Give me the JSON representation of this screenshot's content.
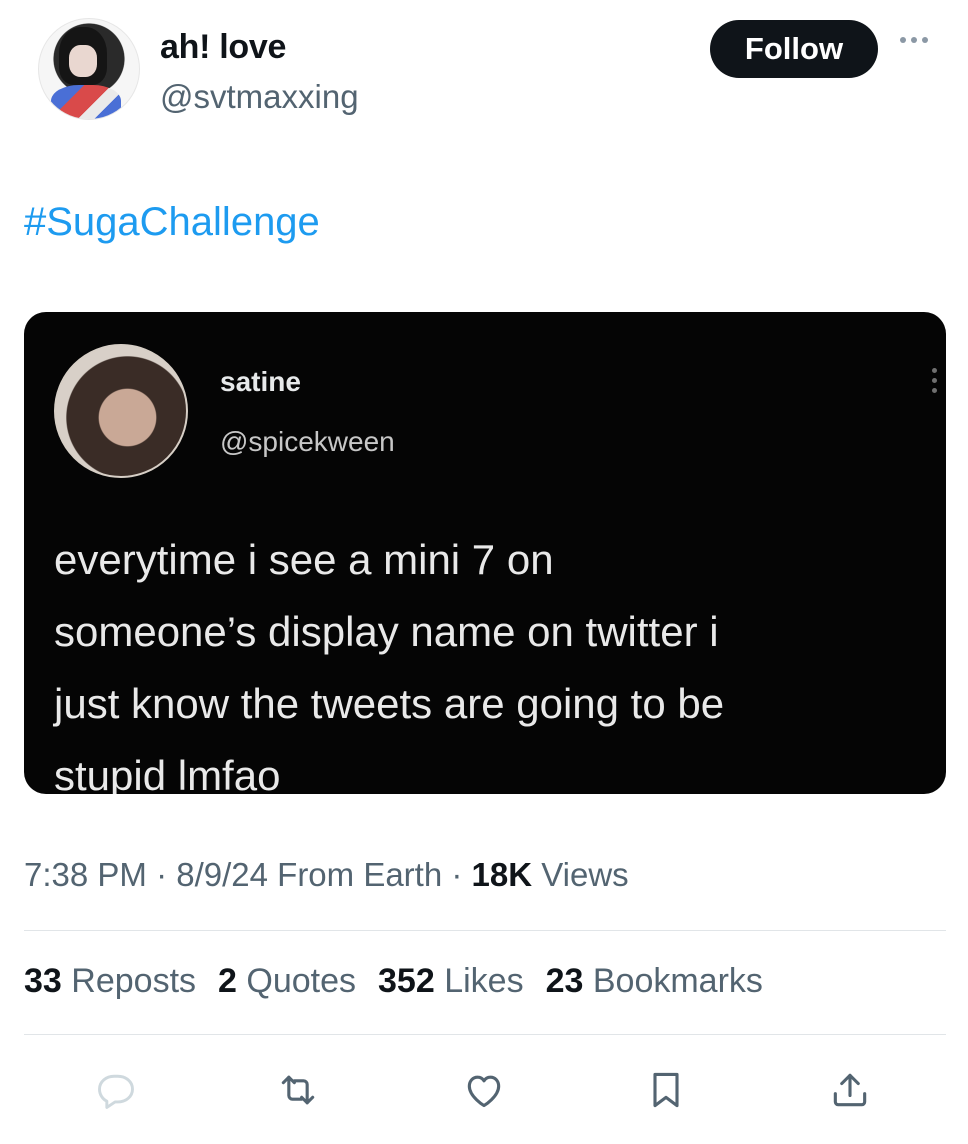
{
  "author": {
    "display_name": "ah! love",
    "handle": "@svtmaxxing",
    "follow_label": "Follow"
  },
  "post": {
    "hashtag": "#SugaChallenge",
    "quoted": {
      "display_name": "satine",
      "handle": "@spicekween",
      "text": "everytime i see a mini 7 on\nsomeone’s display name on twitter i\njust know the tweets are going to be\nstupid lmfao"
    },
    "meta": {
      "time": "7:38 PM",
      "date": "8/9/24",
      "source": "From Earth",
      "views_count": "18K",
      "views_label": "Views"
    },
    "stats": [
      {
        "count": "33",
        "label": "Reposts"
      },
      {
        "count": "2",
        "label": "Quotes"
      },
      {
        "count": "352",
        "label": "Likes"
      },
      {
        "count": "23",
        "label": "Bookmarks"
      }
    ]
  },
  "icons": {
    "reply": "reply-icon",
    "repost": "repost-icon",
    "like": "heart-icon",
    "bookmark": "bookmark-icon",
    "share": "share-icon"
  },
  "colors": {
    "accent": "#1d9bf0",
    "text_primary": "#0f1419",
    "text_secondary": "#536471",
    "follow_bg": "#0f1419"
  }
}
